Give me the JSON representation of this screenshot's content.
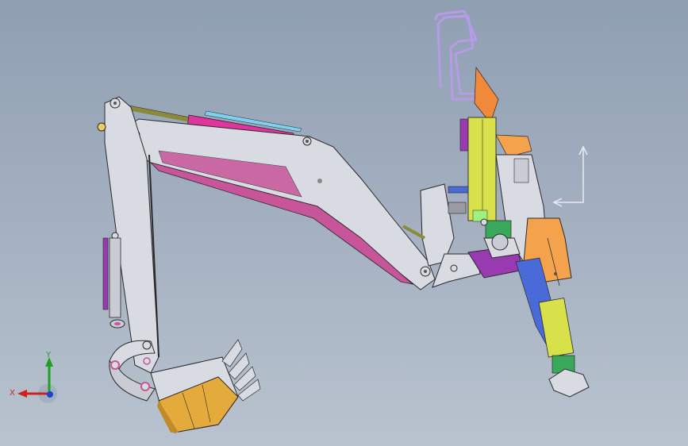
{
  "viewport": {
    "name": "cad-3d-graphics-area",
    "background_top": "#8f9fb2",
    "background_bottom": "#b9c3cf"
  },
  "model": {
    "name": "excavator-arm-assembly",
    "colors": {
      "structure": "#d9dbe2",
      "structure_shade": "#b7bac4",
      "edge": "#2a2a2a",
      "magenta": "#c8559a",
      "cylinder_pink": "#e0359f",
      "rod": "#8a8a38",
      "bucket": "#e4aa3c",
      "bucket_dark": "#c08a26",
      "yellow_green": "#d8e04a",
      "orange": "#f08a3a",
      "light_orange": "#f4a24c",
      "green": "#3aa85a",
      "blue": "#4a6ad8",
      "purple": "#9a3ab0",
      "lavender": "#b99ae8",
      "cyan": "#4ab8d8"
    }
  },
  "triad": {
    "x_label": "X",
    "y_label": "Y",
    "x_color": "#d02020",
    "y_color": "#20a020",
    "z_color": "#2040d0"
  },
  "reference_arrows": {
    "color": "#e8ecf2"
  }
}
